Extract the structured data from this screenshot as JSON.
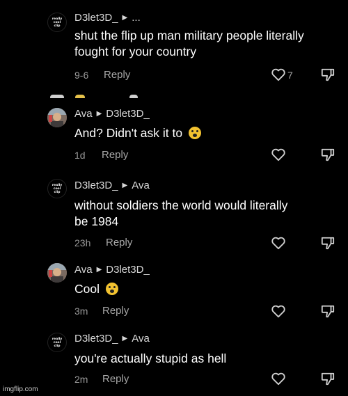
{
  "comments": [
    {
      "author": "D3let3D_",
      "reply_to": "...",
      "avatar_text": [
        "really cool",
        "clip"
      ],
      "text": "shut the flip up man military people literally fought for your country",
      "time": "9-6",
      "reply_label": "Reply",
      "likes": "7"
    },
    {
      "author": "Ava",
      "reply_to": "D3let3D_",
      "text": "And? Didn't ask it to",
      "emoji": "screaming-face",
      "time": "1d",
      "reply_label": "Reply"
    },
    {
      "author": "D3let3D_",
      "reply_to": "Ava",
      "avatar_text": [
        "really cool",
        "clip"
      ],
      "text": "without soldiers the world would literally be 1984",
      "time": "23h",
      "reply_label": "Reply"
    },
    {
      "author": "Ava",
      "reply_to": "D3let3D_",
      "text": "Cool",
      "emoji": "screaming-face",
      "time": "3m",
      "reply_label": "Reply"
    },
    {
      "author": "D3let3D_",
      "reply_to": "Ava",
      "avatar_text": [
        "really cool",
        "clip"
      ],
      "text": "you're actually stupid as hell",
      "time": "2m",
      "reply_label": "Reply"
    }
  ],
  "icons": {
    "like": "heart-icon",
    "dislike": "thumbs-down-icon",
    "reply_arrow": "triangle-right-icon"
  },
  "watermark": "imgflip.com"
}
